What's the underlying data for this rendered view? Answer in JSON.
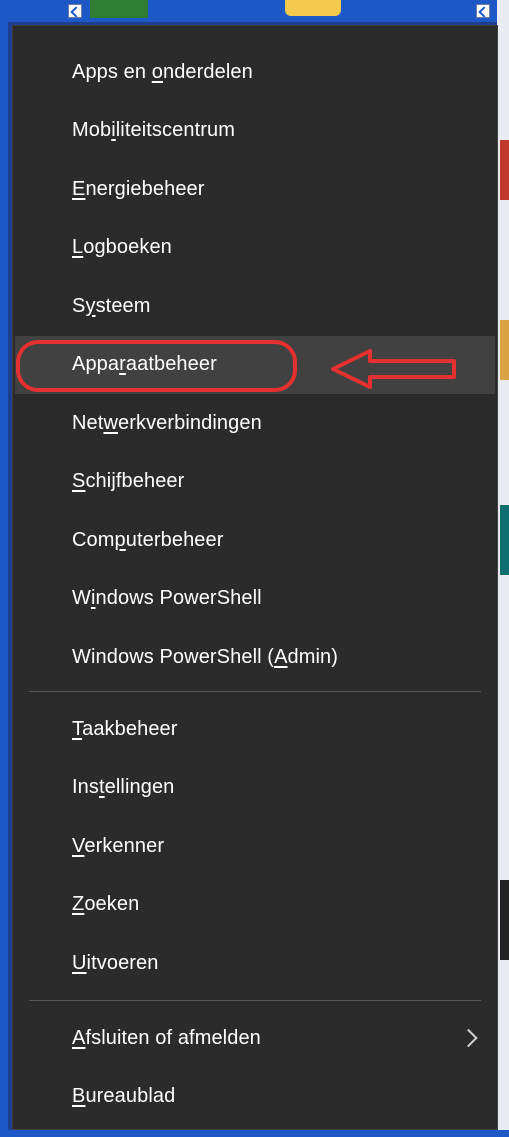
{
  "menu": {
    "group1": [
      {
        "key": "apps",
        "pre": "Apps en ",
        "ul": "o",
        "post": "nderdelen"
      },
      {
        "key": "mobility",
        "pre": "Mob",
        "ul": "i",
        "post": "liteitscentrum"
      },
      {
        "key": "power",
        "pre": "",
        "ul": "E",
        "post": "nergiebeheer"
      },
      {
        "key": "eventlog",
        "pre": "",
        "ul": "L",
        "post": "ogboeken"
      },
      {
        "key": "system",
        "pre": "S",
        "ul": "y",
        "post": "steem"
      },
      {
        "key": "devmgr",
        "pre": "Appa",
        "ul": "r",
        "post": "aatbeheer"
      },
      {
        "key": "network",
        "pre": "Net",
        "ul": "w",
        "post": "erkverbindingen"
      },
      {
        "key": "disk",
        "pre": "",
        "ul": "S",
        "post": "chijfbeheer"
      },
      {
        "key": "computer",
        "pre": "Com",
        "ul": "p",
        "post": "uterbeheer"
      },
      {
        "key": "powershell",
        "pre": "W",
        "ul": "i",
        "post": "ndows PowerShell"
      },
      {
        "key": "powershell-admin",
        "pre": "Windows PowerShell (",
        "ul": "A",
        "post": "dmin)"
      }
    ],
    "group2": [
      {
        "key": "taskmgr",
        "pre": "",
        "ul": "T",
        "post": "aakbeheer"
      },
      {
        "key": "settings",
        "pre": "Ins",
        "ul": "t",
        "post": "ellingen"
      },
      {
        "key": "explorer",
        "pre": "",
        "ul": "V",
        "post": "erkenner"
      },
      {
        "key": "search",
        "pre": "",
        "ul": "Z",
        "post": "oeken"
      },
      {
        "key": "run",
        "pre": "",
        "ul": "U",
        "post": "itvoeren"
      }
    ],
    "group3": [
      {
        "key": "shutdown",
        "pre": "",
        "ul": "A",
        "post": "fsluiten of afmelden",
        "submenu": true
      },
      {
        "key": "desktop",
        "pre": "",
        "ul": "B",
        "post": "ureaublad"
      }
    ]
  },
  "highlighted_item": "devmgr",
  "colors": {
    "menu_background": "#2b2b2b",
    "hover_background": "#414141",
    "annotation_red": "#e53030",
    "text": "#ffffff"
  },
  "icons": {
    "submenu_indicator": "chevron-right-icon",
    "annotation": "arrow-left-icon"
  }
}
